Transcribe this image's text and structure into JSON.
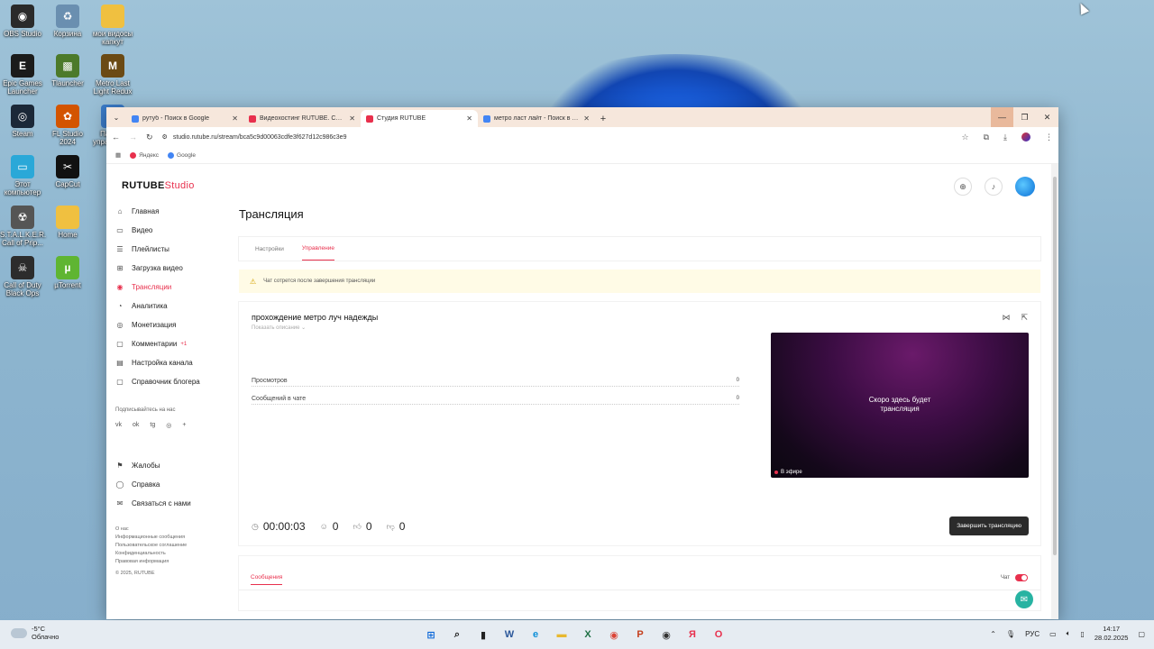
{
  "desktop": {
    "icons": [
      {
        "label": "OBS Studio",
        "glyph": "◉",
        "color": "#2a2a2a"
      },
      {
        "label": "Корзина",
        "glyph": "♻",
        "color": "#6a8fb0"
      },
      {
        "label": "мои видосы капкут",
        "glyph": "",
        "color": "#f0c040"
      },
      {
        "label": "Epic Games Launcher",
        "glyph": "E",
        "color": "#1b1b1b"
      },
      {
        "label": "Tlauncher",
        "glyph": "▩",
        "color": "#4c7a2a"
      },
      {
        "label": "Metro Last Light Redux",
        "glyph": "M",
        "color": "#6b4a14"
      },
      {
        "label": "Steam",
        "glyph": "◎",
        "color": "#1b2838"
      },
      {
        "label": "FL Studio 2024",
        "glyph": "✿",
        "color": "#d35400"
      },
      {
        "label": "Панель управления",
        "glyph": "▦",
        "color": "#3a7bc8"
      },
      {
        "label": "Этот компьютер",
        "glyph": "▭",
        "color": "#2aa8d8"
      },
      {
        "label": "CapCut",
        "glyph": "✂",
        "color": "#111111"
      },
      {
        "label": "S.T.A.L.K.E.R. Call of Prip...",
        "glyph": "☢",
        "color": "#555555"
      },
      {
        "label": "Home",
        "glyph": "",
        "color": "#f0c040"
      },
      {
        "label": "Call of Duty Black Ops",
        "glyph": "☠",
        "color": "#2c2c2c"
      },
      {
        "label": "µTorrent",
        "glyph": "µ",
        "color": "#5fb532"
      }
    ]
  },
  "browser": {
    "tabs": [
      {
        "title": "рутуб - Поиск в Google",
        "favicon_color": "#4285f4",
        "active": false
      },
      {
        "title": "Видеохостинг RUTUBE. Смотр...",
        "favicon_color": "#e8304d",
        "active": false
      },
      {
        "title": "Студия RUTUBE",
        "favicon_color": "#e8304d",
        "active": true
      },
      {
        "title": "метро ласт лайт - Поиск в Go...",
        "favicon_color": "#4285f4",
        "active": false
      }
    ],
    "close_glyph": "✕",
    "new_tab_glyph": "+",
    "url": "studio.rutube.ru/stream/bca5c9d00063cdfe3f627d12c986c3e9",
    "bookmarks": [
      {
        "label": "Яндекс",
        "color": "#e8304d"
      },
      {
        "label": "Google",
        "color": "#4285f4"
      }
    ]
  },
  "studio": {
    "logo_main": "RUTUBE",
    "logo_sub": "Studio",
    "accent": "#e8304d",
    "nav": [
      {
        "label": "Главная",
        "icon": "⌂",
        "name": "home"
      },
      {
        "label": "Видео",
        "icon": "▭",
        "name": "video"
      },
      {
        "label": "Плейлисты",
        "icon": "☰",
        "name": "playlists"
      },
      {
        "label": "Загрузка видео",
        "icon": "⊞",
        "name": "upload"
      },
      {
        "label": "Трансляции",
        "icon": "◉",
        "name": "streams",
        "active": true
      },
      {
        "label": "Аналитика",
        "icon": "◔",
        "name": "analytics"
      },
      {
        "label": "Монетизация",
        "icon": "◎",
        "name": "monetization"
      },
      {
        "label": "Комментарии",
        "icon": "▢",
        "name": "comments",
        "badge": "+1"
      },
      {
        "label": "Настройка канала",
        "icon": "▤",
        "name": "channel-settings"
      },
      {
        "label": "Справочник блогера",
        "icon": "▢",
        "name": "blogger-guide"
      }
    ],
    "follow_title": "Подписывайтесь на нас",
    "socials": [
      "vk",
      "ok",
      "tg",
      "◎",
      "+"
    ],
    "bottom_nav": [
      {
        "label": "Жалобы",
        "icon": "⚑",
        "name": "complaints"
      },
      {
        "label": "Справка",
        "icon": "◯",
        "name": "help"
      },
      {
        "label": "Связаться с нами",
        "icon": "✉",
        "name": "contact"
      }
    ],
    "footer_links": [
      "О нас",
      "Информационные сообщения",
      "Пользовательское соглашение",
      "Конфиденциальность",
      "Правовая информация"
    ],
    "copyright": "© 2025, RUTUBE",
    "page_title": "Трансляция",
    "tabs": [
      {
        "label": "Настройки",
        "active": false
      },
      {
        "label": "Управление",
        "active": true
      }
    ],
    "notice": "Чат сотрется после завершения трансляции",
    "stream": {
      "title": "прохождение метро луч надежды",
      "show_description": "Показать описание",
      "stats": [
        {
          "label": "Просмотров",
          "value": "0"
        },
        {
          "label": "Сообщений в чате",
          "value": "0"
        }
      ],
      "preview_text_line1": "Скоро здесь будет",
      "preview_text_line2": "трансляция",
      "live_label": "В эфире",
      "timer": "00:00:03",
      "viewers": "0",
      "likes": "0",
      "dislikes": "0",
      "end_button": "Завершить трансляцию"
    },
    "messages_tab": "Сообщения",
    "chat_label": "Чат"
  },
  "taskbar": {
    "weather_temp": "-5°C",
    "weather_desc": "Облачно",
    "apps": [
      {
        "glyph": "⊞",
        "color": "#0a66d8",
        "name": "start"
      },
      {
        "glyph": "⌕",
        "color": "#222222",
        "name": "search"
      },
      {
        "glyph": "▮",
        "color": "#222222",
        "name": "task-view"
      },
      {
        "glyph": "W",
        "color": "#2b579a",
        "name": "word"
      },
      {
        "glyph": "e",
        "color": "#0c8fd8",
        "name": "edge"
      },
      {
        "glyph": "▬",
        "color": "#e8b830",
        "name": "explorer"
      },
      {
        "glyph": "X",
        "color": "#1d7044",
        "name": "excel"
      },
      {
        "glyph": "◉",
        "color": "#db4437",
        "name": "chrome"
      },
      {
        "glyph": "P",
        "color": "#c43e1c",
        "name": "powerpoint"
      },
      {
        "glyph": "◉",
        "color": "#333333",
        "name": "obs"
      },
      {
        "glyph": "Я",
        "color": "#e8304d",
        "name": "yandex"
      },
      {
        "glyph": "O",
        "color": "#e8304d",
        "name": "opera"
      }
    ],
    "lang": "РУС",
    "time": "14:17",
    "date": "28.02.2025"
  }
}
